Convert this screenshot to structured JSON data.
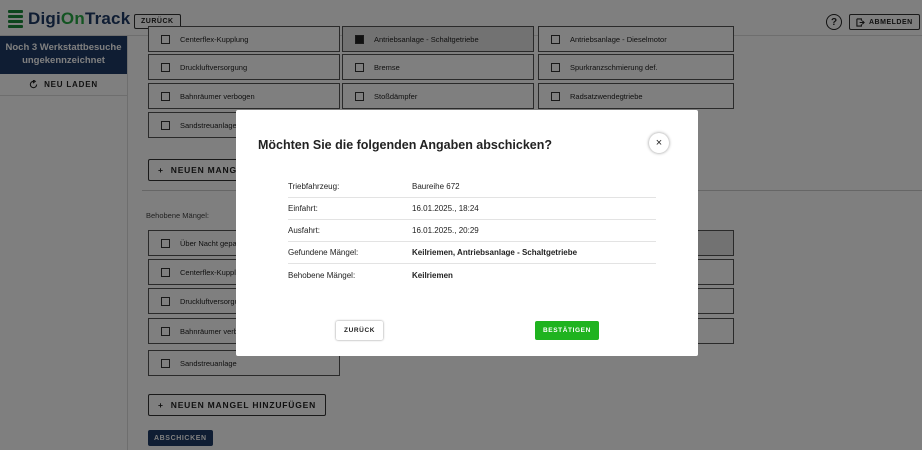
{
  "header": {
    "logo_part1": "Digi",
    "logo_part2": "On",
    "logo_part3": "Track",
    "back_label": "ZURÜCK",
    "help_label": "?",
    "logout_label": "ABMELDEN"
  },
  "sidebar": {
    "visits_text": "Noch 3 Werkstattbesuche ungekennzeichnet",
    "reload_label": "NEU LADEN"
  },
  "main": {
    "found_items": [
      {
        "label": "Centerflex-Kupplung",
        "checked": false
      },
      {
        "label": "Antriebsanlage - Schaltgetriebe",
        "checked": true
      },
      {
        "label": "Antriebsanlage - Dieselmotor",
        "checked": false
      },
      {
        "label": "Druckluftversorgung",
        "checked": false
      },
      {
        "label": "Bremse",
        "checked": false
      },
      {
        "label": "Spurkranzschmierung def.",
        "checked": false
      },
      {
        "label": "Bahnräumer verbogen",
        "checked": false
      },
      {
        "label": "Stoßdämpfer",
        "checked": false
      },
      {
        "label": "Radsatzwendegtriebe",
        "checked": false
      },
      {
        "label": "Sandstreuanlage",
        "checked": false
      }
    ],
    "add_found_label": "NEUEN MANGEL HINZUFÜGEN",
    "fixed_section_label": "Behobene Mängel:",
    "fixed_items": [
      {
        "label": "Über Nacht gepanzert",
        "checked": false
      },
      {
        "label": "Centerflex-Kupplung",
        "checked": false
      },
      {
        "label": "Druckluftversorgung",
        "checked": false
      },
      {
        "label": "Bahnräumer verbogen",
        "checked": false
      },
      {
        "label": "Sandstreuanlage",
        "checked": false
      }
    ],
    "add_fixed_label": "NEUEN MANGEL HINZUFÜGEN",
    "submit_label": "ABSCHICKEN"
  },
  "dialog": {
    "title": "Möchten Sie die folgenden Angaben abschicken?",
    "close_symbol": "×",
    "rows": [
      {
        "key": "Triebfahrzeug:",
        "value": "Baureihe 672"
      },
      {
        "key": "Einfahrt:",
        "value": "16.01.2025., 18:24"
      },
      {
        "key": "Ausfahrt:",
        "value": "16.01.2025., 20:29"
      },
      {
        "key": "Gefundene Mängel:",
        "value": "Keilriemen, Antriebsanlage - Schaltgetriebe"
      },
      {
        "key": "Behobene Mängel:",
        "value": "Keilriemen"
      }
    ],
    "back_label": "ZURÜCK",
    "confirm_label": "BESTÄTIGEN"
  },
  "colors": {
    "brand_navy": "#1e3a66",
    "brand_green": "#27a844",
    "confirm_green": "#1fb31f"
  }
}
